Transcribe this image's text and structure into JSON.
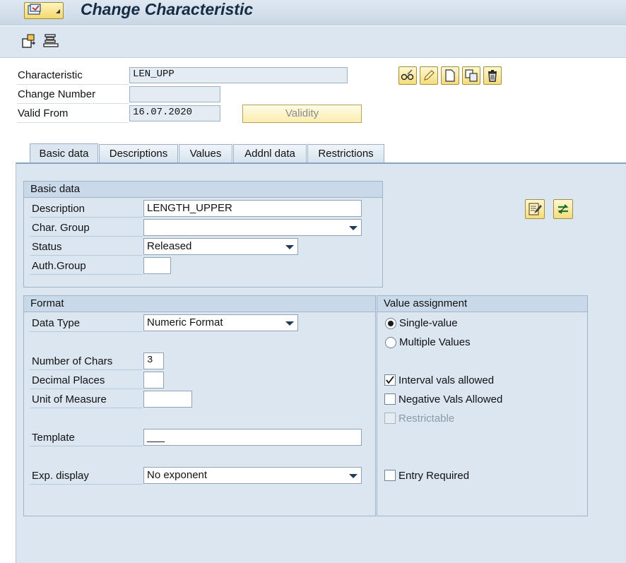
{
  "window": {
    "title": "Change Characteristic"
  },
  "header": {
    "characteristic_label": "Characteristic",
    "characteristic_value": "LEN_UPP",
    "change_number_label": "Change Number",
    "change_number_value": "",
    "valid_from_label": "Valid From",
    "valid_from_value": "16.07.2020",
    "validity_button": "Validity"
  },
  "tabs": [
    {
      "label": "Basic data",
      "active": true
    },
    {
      "label": "Descriptions"
    },
    {
      "label": "Values"
    },
    {
      "label": "Addnl data"
    },
    {
      "label": "Restrictions"
    }
  ],
  "basic_data": {
    "group_title": "Basic data",
    "description_label": "Description",
    "description_value": "LENGTH_UPPER",
    "char_group_label": "Char. Group",
    "char_group_value": "",
    "status_label": "Status",
    "status_value": "Released",
    "auth_group_label": "Auth.Group",
    "auth_group_value": ""
  },
  "format": {
    "group_title": "Format",
    "data_type_label": "Data Type",
    "data_type_value": "Numeric Format",
    "num_chars_label": "Number of Chars",
    "num_chars_value": "3",
    "decimal_places_label": "Decimal Places",
    "decimal_places_value": "",
    "uom_label": "Unit of Measure",
    "uom_value": "",
    "template_label": "Template",
    "template_value": "___",
    "exp_display_label": "Exp. display",
    "exp_display_value": "No exponent"
  },
  "value_assignment": {
    "group_title": "Value assignment",
    "single_value_label": "Single-value",
    "multiple_values_label": "Multiple Values",
    "selected": "Single-value",
    "interval_label": "Interval vals allowed",
    "interval_checked": true,
    "negative_label": "Negative Vals Allowed",
    "negative_checked": false,
    "restrictable_label": "Restrictable",
    "restrictable_disabled": true,
    "entry_required_label": "Entry Required",
    "entry_required_checked": false
  },
  "colors": {
    "content_bg": "#dbe6f1",
    "group_header": "#c9d9e9",
    "button_yellow": "#f4dd7c"
  }
}
